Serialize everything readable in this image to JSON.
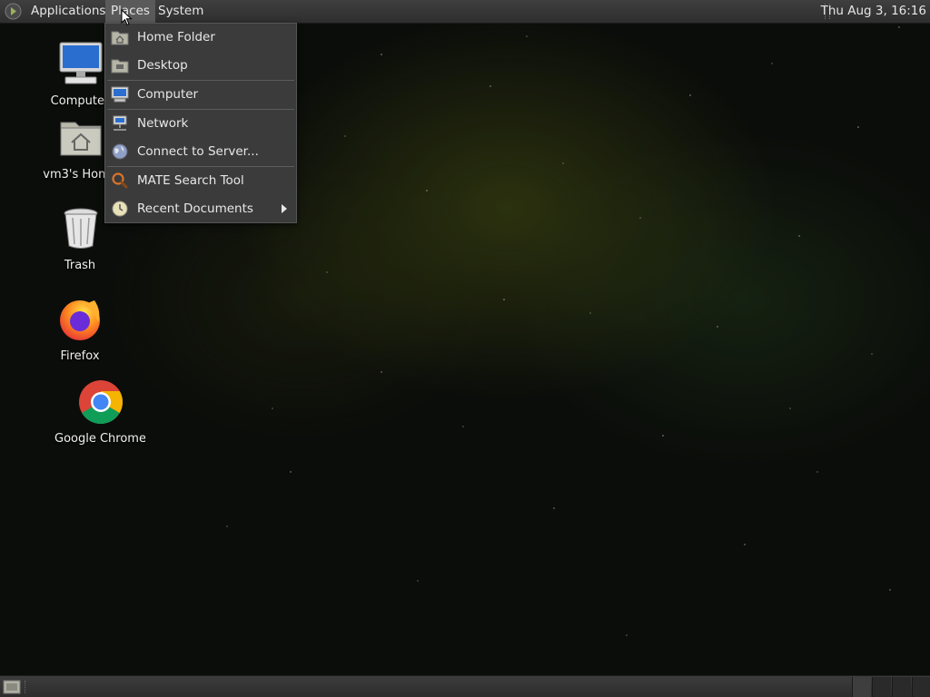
{
  "top_panel": {
    "menus": [
      "Applications",
      "Places",
      "System"
    ],
    "active_menu": "Places",
    "clock": "Thu Aug  3, 16:16"
  },
  "places_menu": {
    "items": [
      {
        "label": "Home Folder",
        "icon": "home-folder-icon"
      },
      {
        "label": "Desktop",
        "icon": "desktop-folder-icon"
      },
      {
        "label": "Computer",
        "icon": "computer-icon"
      },
      {
        "label": "Network",
        "icon": "network-icon"
      },
      {
        "label": "Connect to Server...",
        "icon": "globe-icon"
      },
      {
        "label": "MATE Search Tool",
        "icon": "search-icon"
      },
      {
        "label": "Recent Documents",
        "icon": "recent-documents-icon",
        "has_submenu": true
      }
    ]
  },
  "desktop_icons": [
    {
      "label": "Computer",
      "icon": "computer-icon"
    },
    {
      "label": "vm3's Home",
      "icon": "home-folder-icon"
    },
    {
      "label": "Trash",
      "icon": "trash-icon"
    },
    {
      "label": "Firefox",
      "icon": "firefox-icon"
    },
    {
      "label": "Google Chrome",
      "icon": "chrome-icon"
    }
  ],
  "colors": {
    "panel": "#3f3f3f",
    "menu_bg": "#3b3b3b",
    "menu_active": "#5a5a5a",
    "desktop_bg": "#0b0d0a"
  }
}
